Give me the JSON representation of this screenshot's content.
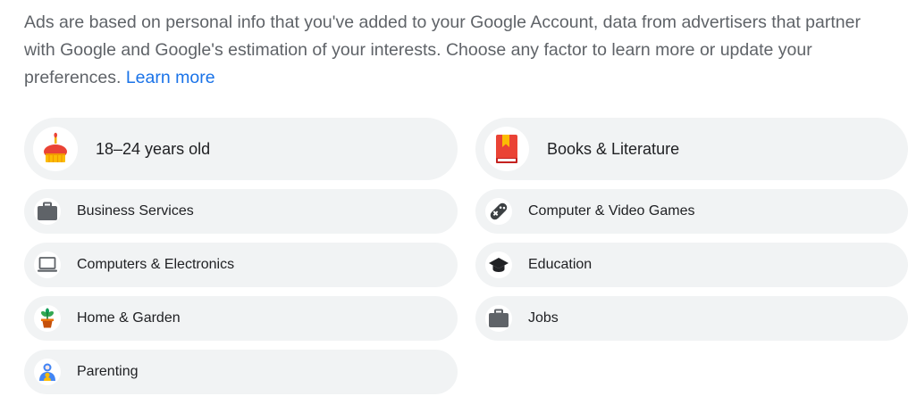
{
  "intro": {
    "text": "Ads are based on personal info that you've added to your Google Account, data from advertisers that partner with Google and Google's estimation of your interests. Choose any factor to learn more or update your preferences.",
    "learn_more": "Learn more"
  },
  "factors": {
    "age": {
      "label": "18–24 years old",
      "icon": "birthday-cake-icon"
    },
    "books": {
      "label": "Books & Literature",
      "icon": "book-icon"
    },
    "business": {
      "label": "Business Services",
      "icon": "briefcase-icon"
    },
    "games": {
      "label": "Computer & Video Games",
      "icon": "gamepad-icon"
    },
    "computers": {
      "label": "Computers & Electronics",
      "icon": "laptop-icon"
    },
    "education": {
      "label": "Education",
      "icon": "graduation-cap-icon"
    },
    "home": {
      "label": "Home & Garden",
      "icon": "potted-plant-icon"
    },
    "jobs": {
      "label": "Jobs",
      "icon": "briefcase-icon"
    },
    "parenting": {
      "label": "Parenting",
      "icon": "parent-child-icon"
    }
  },
  "colors": {
    "link": "#1a73e8",
    "chip_background": "#f1f3f4",
    "intro_text": "#5f6368",
    "label_text": "#202124"
  }
}
